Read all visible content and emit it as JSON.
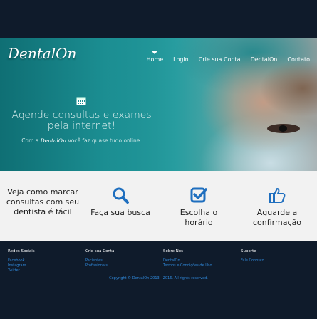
{
  "brand": {
    "logo_text": "DentalOn"
  },
  "nav": {
    "items": [
      {
        "label": "Home"
      },
      {
        "label": "Login"
      },
      {
        "label": "Crie sua Conta"
      },
      {
        "label": "DentalOn"
      },
      {
        "label": "Contato"
      }
    ]
  },
  "hero": {
    "headline": "Agende consultas e exames pela internet!",
    "sub_prefix": "Com a",
    "sub_brand": "DentalOn",
    "sub_suffix": "você faz quase tudo online."
  },
  "features": {
    "intro": "Veja como marcar consultas com seu dentista é fácil",
    "steps": [
      {
        "label": "Faça sua busca",
        "icon": "search-icon"
      },
      {
        "label": "Escolha o horário",
        "icon": "check-square-icon"
      },
      {
        "label": "Aguarde a confirmação",
        "icon": "thumbs-up-icon"
      }
    ],
    "accent_color": "#1f6fbf"
  },
  "footer": {
    "columns": [
      {
        "title": "Redes Sociais",
        "links": [
          "Facebook",
          "Instagram",
          "Twitter"
        ]
      },
      {
        "title": "Crie sua Conta",
        "links": [
          "Pacientes",
          "Profissionais"
        ]
      },
      {
        "title": "Sobre Nós",
        "links": [
          "DentalOn",
          "Termos e Condições de Uso"
        ]
      },
      {
        "title": "Suporte",
        "links": [
          "Fale Conosco"
        ]
      }
    ],
    "copyright": "Copyright © DentalOn 2013 - 2016. All rights reserved."
  }
}
